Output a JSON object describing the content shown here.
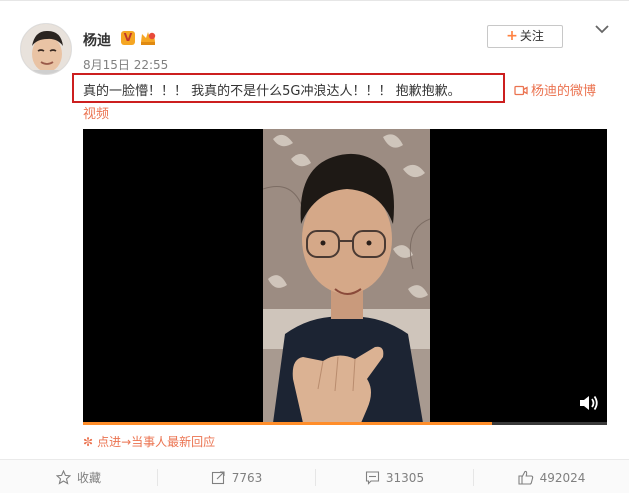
{
  "post": {
    "author_name": "杨迪",
    "verified_badge": "V",
    "timestamp": "8月15日 22:55",
    "follow_label": "关注",
    "text": "真的一脸懵！！！ 我真的不是什么5G冲浪达人！！！ 抱歉抱歉。",
    "source_link_line1": "杨迪的微博",
    "source_link_line2": "视频",
    "follow_up_link": "点进→当事人最新回应"
  },
  "video": {
    "progress_fraction": 0.78
  },
  "actions": {
    "favorite_label": "收藏",
    "repost_count": "7763",
    "comment_count": "31305",
    "like_count": "492024"
  },
  "icons": {
    "chevron": "chevron-down-icon",
    "video_source": "video-camera-icon",
    "volume": "volume-icon",
    "favorite": "star-icon",
    "repost": "repost-icon",
    "comment": "comment-icon",
    "like": "thumbs-up-icon"
  },
  "colors": {
    "accent_orange": "#eb7350",
    "highlight_red": "#cc1f1f",
    "progress_orange": "#ff8d29"
  }
}
